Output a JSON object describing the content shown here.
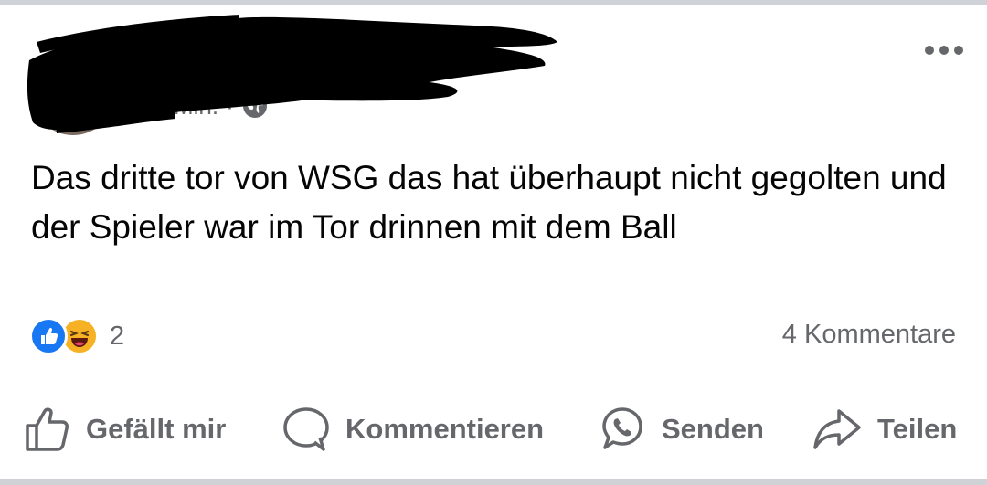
{
  "post": {
    "author_name": "",
    "time": "Min.",
    "separator": "·",
    "audience_icon": "globe-icon",
    "text": "Das dritte tor von WSG das hat überhaupt nicht gegolten und der Spieler war im Tor drinnen mit dem Ball",
    "more_icon": "more-dots-icon"
  },
  "reactions": {
    "icons": [
      "like-icon",
      "haha-icon"
    ],
    "count": "2",
    "comments": "4 Kommentare"
  },
  "actions": {
    "like_label": "Gefällt mir",
    "comment_label": "Kommentieren",
    "send_label": "Senden",
    "share_label": "Teilen"
  },
  "colors": {
    "text": "#050505",
    "secondary": "#65676b",
    "like_blue": "#1877f2",
    "haha_yellow": "#f7b125",
    "divider": "#cfd2d6"
  }
}
